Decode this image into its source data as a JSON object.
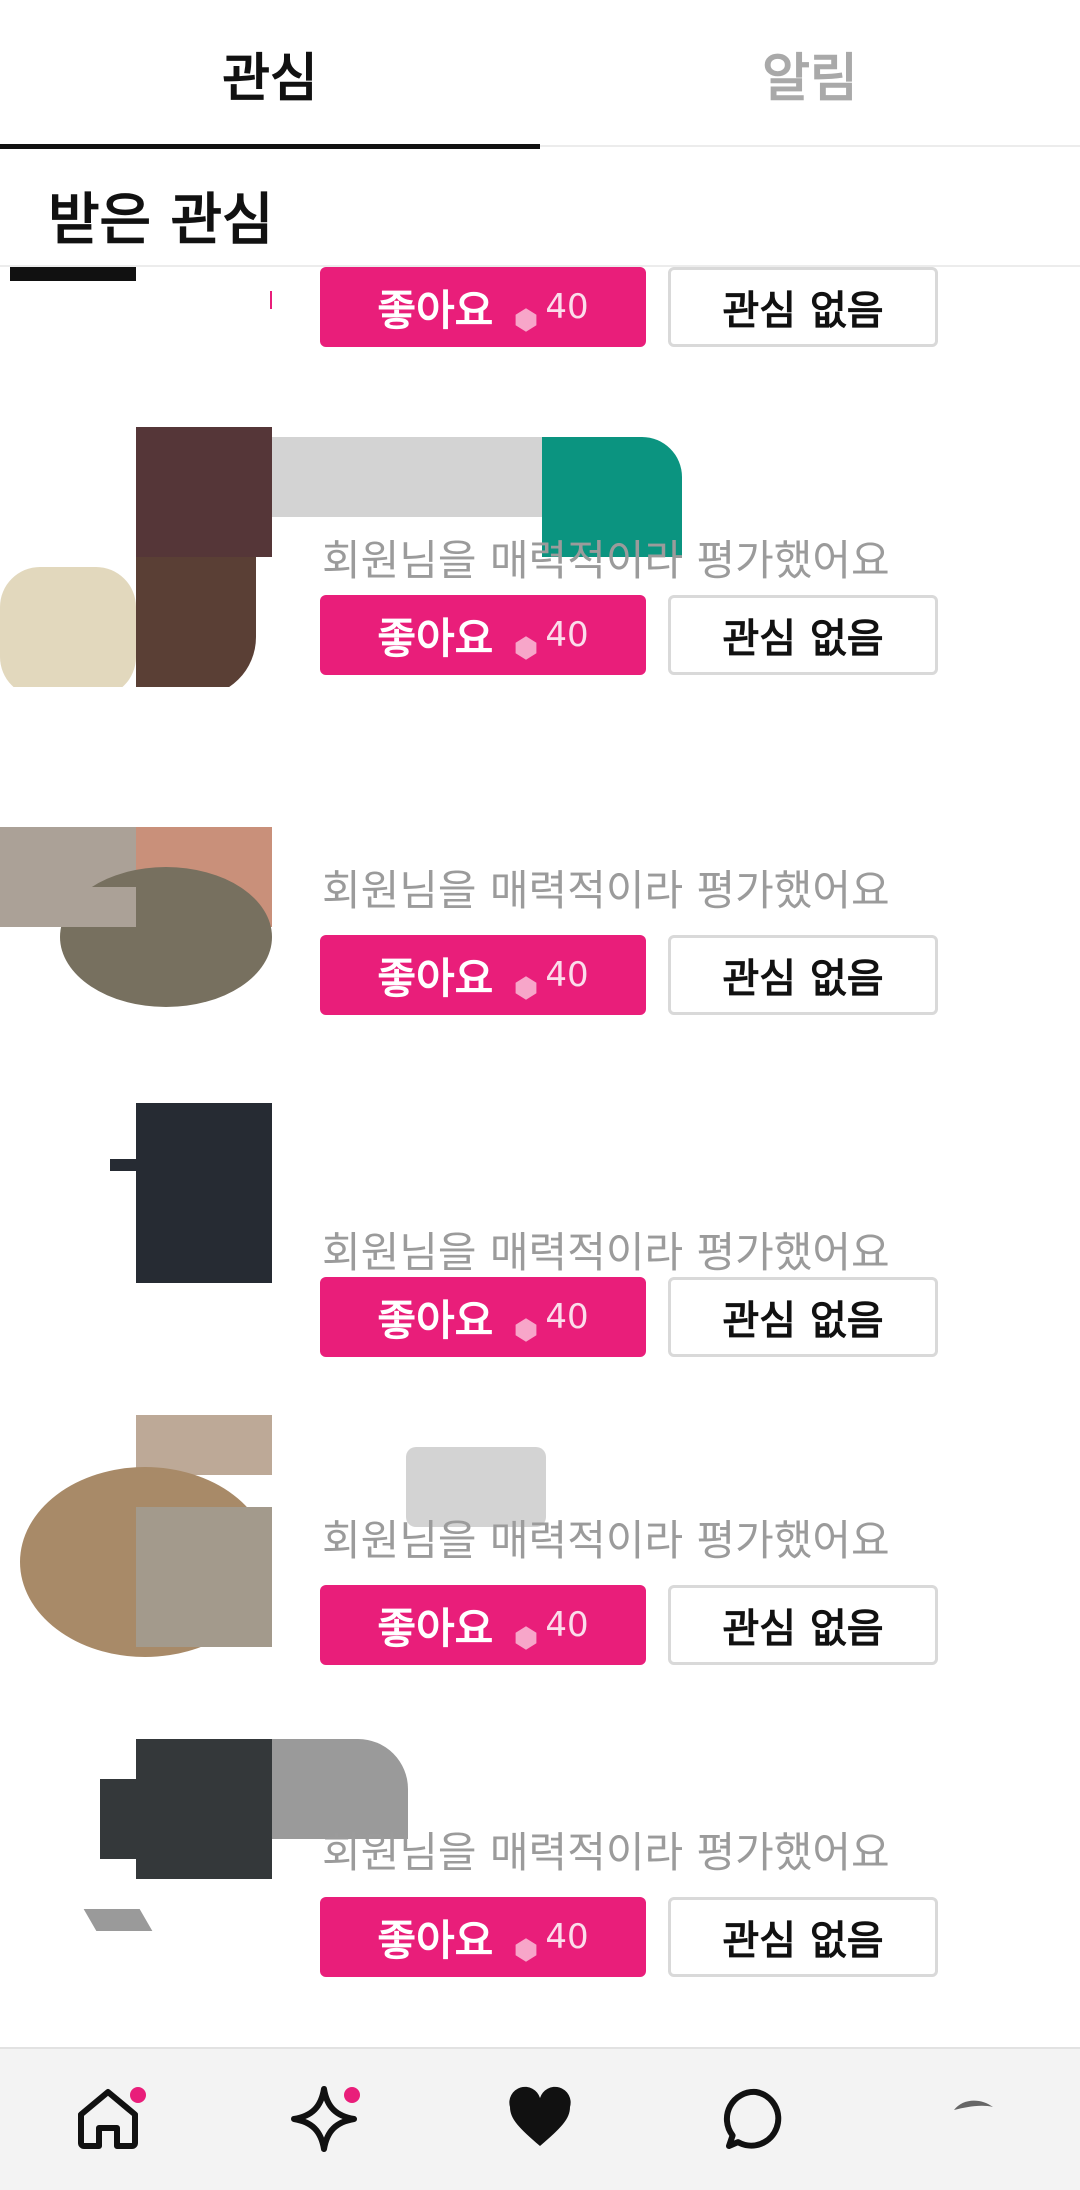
{
  "tabs": [
    {
      "label": "관심",
      "active": true
    },
    {
      "label": "알림",
      "active": false
    }
  ],
  "section": {
    "title": "받은 관심"
  },
  "cards": [
    {
      "message": "",
      "like_label": "좋아요",
      "cost": "40",
      "pass_label": "관심 없음"
    },
    {
      "message": "회원님을 매력적이라 평가했어요",
      "like_label": "좋아요",
      "cost": "40",
      "pass_label": "관심 없음"
    },
    {
      "message": "회원님을 매력적이라 평가했어요",
      "like_label": "좋아요",
      "cost": "40",
      "pass_label": "관심 없음"
    },
    {
      "message": "회원님을 매력적이라 평가했어요",
      "like_label": "좋아요",
      "cost": "40",
      "pass_label": "관심 없음"
    },
    {
      "message": "회원님을 매력적이라 평가했어요",
      "like_label": "좋아요",
      "cost": "40",
      "pass_label": "관심 없음"
    },
    {
      "message": "회원님을 매력적이라 평가했어요",
      "like_label": "좋아요",
      "cost": "40",
      "pass_label": "관심 없음"
    }
  ],
  "nav": [
    {
      "icon": "home-icon",
      "badge": true
    },
    {
      "icon": "sparkle-icon",
      "badge": true
    },
    {
      "icon": "heart-icon",
      "badge": false
    },
    {
      "icon": "chat-bubble-icon",
      "badge": false
    },
    {
      "icon": "profile-avatar",
      "badge": false
    }
  ],
  "colors": {
    "accent": "#e91e7a",
    "text": "#111111",
    "muted": "#9b9b9b",
    "nav_bg": "#f3f3f3"
  }
}
